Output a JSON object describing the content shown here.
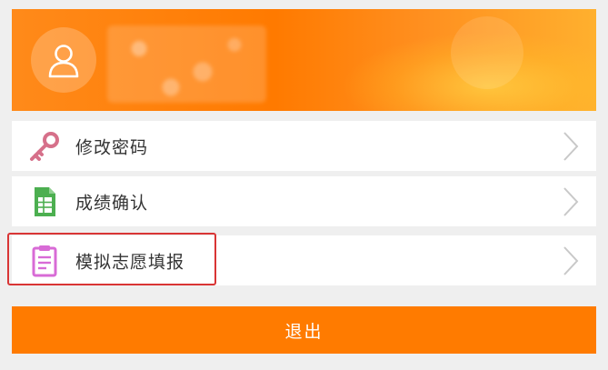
{
  "menu": {
    "items": [
      {
        "label": "修改密码",
        "icon": "key-icon"
      },
      {
        "label": "成绩确认",
        "icon": "spreadsheet-doc-icon"
      },
      {
        "label": "模拟志愿填报",
        "icon": "clipboard-icon"
      }
    ]
  },
  "logout": {
    "label": "退出"
  },
  "colors": {
    "accent": "#ff7b00",
    "highlight": "#d93535",
    "key_icon": "#d6708a",
    "doc_icon": "#4caf50",
    "clipboard_icon": "#d86bd6"
  }
}
